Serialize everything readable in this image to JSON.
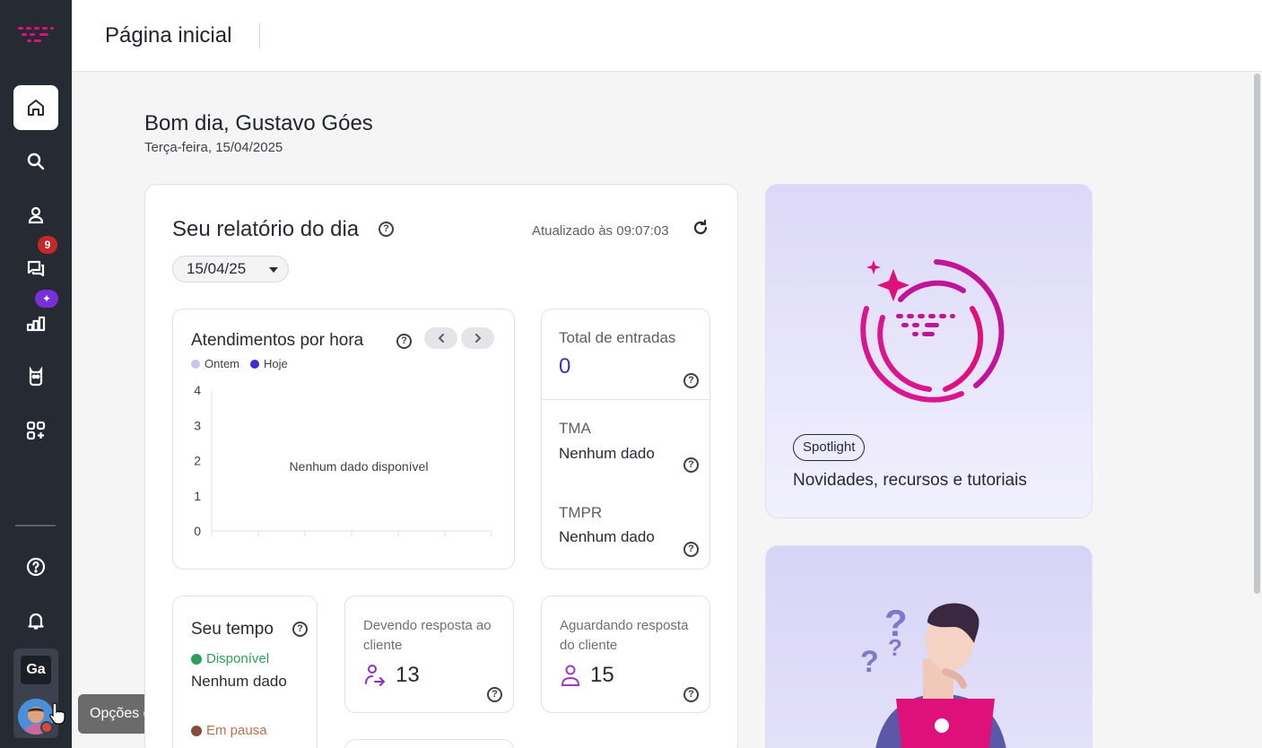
{
  "header": {
    "title": "Página inicial"
  },
  "sidebar": {
    "items": [
      {
        "name": "home",
        "icon": "home-icon",
        "active": true
      },
      {
        "name": "search",
        "icon": "search-icon"
      },
      {
        "name": "contacts",
        "icon": "person-icon"
      },
      {
        "name": "conversations",
        "icon": "chat-icon",
        "badge": "9"
      },
      {
        "name": "reports",
        "icon": "bar-chart-icon",
        "badge": "✦"
      },
      {
        "name": "bots",
        "icon": "bot-icon"
      },
      {
        "name": "apps",
        "icon": "apps-add-icon"
      },
      {
        "name": "help",
        "icon": "help-circle-icon"
      },
      {
        "name": "notifications",
        "icon": "bell-icon"
      }
    ],
    "agent_initials": "Ga",
    "tooltip": "Opções do agente"
  },
  "greeting": {
    "title": "Bom dia, Gustavo Góes",
    "date": "Terça-feira, 15/04/2025"
  },
  "report": {
    "title": "Seu relatório do dia",
    "updated": "Atualizado às 09:07:03",
    "date_selected": "15/04/25"
  },
  "hourly": {
    "title": "Atendimentos por hora",
    "legend": [
      {
        "label": "Ontem",
        "color": "#c9c3f2"
      },
      {
        "label": "Hoje",
        "color": "#3b2fd4"
      }
    ],
    "empty_message": "Nenhum dado disponível"
  },
  "chart_data": {
    "type": "bar",
    "title": "Atendimentos por hora",
    "series": [
      {
        "name": "Ontem",
        "values": []
      },
      {
        "name": "Hoje",
        "values": []
      }
    ],
    "y_ticks": [
      "4",
      "3",
      "2",
      "1",
      "0"
    ],
    "ylim": [
      0,
      4
    ],
    "legend_position": "top-left",
    "annotation": "Nenhum dado disponível"
  },
  "stats": {
    "entries_label": "Total de entradas",
    "entries_value": "0",
    "tma_label": "TMA",
    "tma_value": "Nenhum dado",
    "tmpr_label": "TMPR",
    "tmpr_value": "Nenhum dado"
  },
  "time": {
    "title": "Seu tempo",
    "available_label": "Disponível",
    "available_value": "Nenhum dado",
    "available_color": "#2e9e5b",
    "paused_label": "Em pausa",
    "paused_color": "#8a4a3a"
  },
  "pending_client": {
    "label": "Devendo resposta ao cliente",
    "value": "13"
  },
  "awaiting_client": {
    "label": "Aguardando resposta do cliente",
    "value": "15"
  },
  "spotlight": {
    "tag": "Spotlight",
    "description": "Novidades, recursos e tutoriais"
  },
  "colors": {
    "sidebar_bg": "#262b33",
    "accent_pink": "#e0107a",
    "accent_purple": "#3b2fc4"
  }
}
